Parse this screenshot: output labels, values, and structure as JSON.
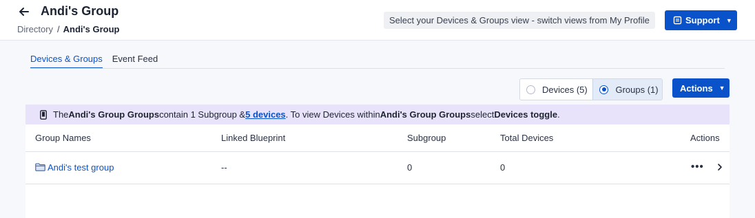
{
  "header": {
    "title": "Andi's Group",
    "breadcrumb": {
      "parent": "Directory",
      "separator": "/",
      "current": "Andi's Group"
    },
    "view_hint": "Select your Devices & Groups view - switch views from My Profile",
    "support_label": "Support"
  },
  "tabs": [
    {
      "label": "Devices & Groups",
      "active": true
    },
    {
      "label": "Event Feed",
      "active": false
    }
  ],
  "toggle": {
    "devices_label": "Devices (5)",
    "groups_label": "Groups (1)",
    "selected": "groups"
  },
  "actions_label": "Actions",
  "banner": {
    "t1": "The ",
    "b1": "Andi's Group Groups",
    "t2": " contain 1 Subgroup & ",
    "link": "5 devices",
    "t3": ". To view Devices within ",
    "b2": "Andi's Group Groups",
    "t4": " select ",
    "b3": "Devices toggle",
    "t5": "."
  },
  "table": {
    "columns": {
      "name": "Group Names",
      "blueprint": "Linked Blueprint",
      "subgroup": "Subgroup",
      "total": "Total Devices",
      "actions": "Actions"
    },
    "rows": [
      {
        "name": "Andi's test group",
        "blueprint": "--",
        "subgroup": "0",
        "total": "0"
      }
    ]
  },
  "colors": {
    "primary": "#0a52c9",
    "banner_bg": "#e8e3fa",
    "page_bg": "#f7f8fc"
  }
}
